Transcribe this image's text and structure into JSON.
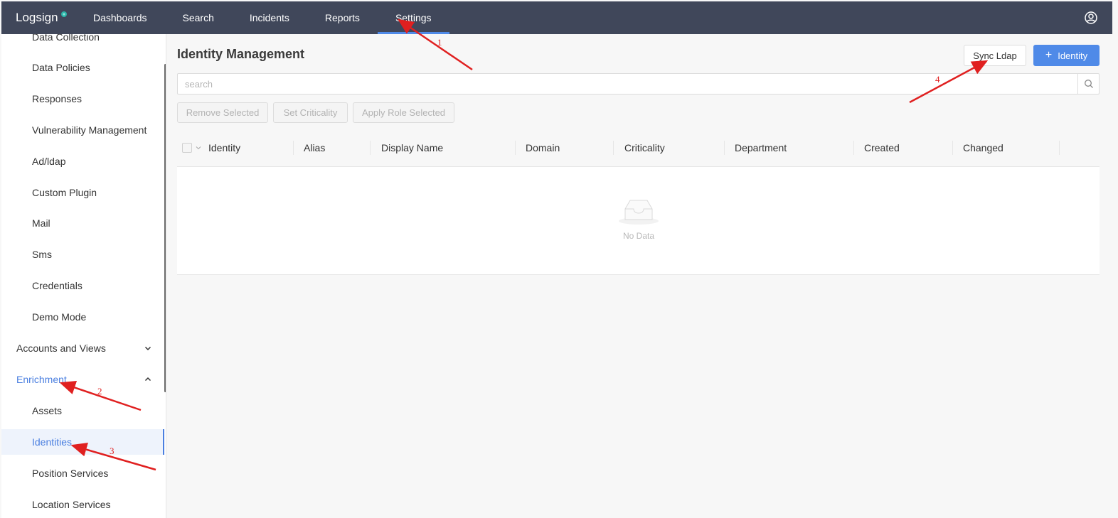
{
  "app": {
    "logo": "Logsign",
    "nav": [
      "Dashboards",
      "Search",
      "Incidents",
      "Reports",
      "Settings"
    ],
    "active_nav": "Settings"
  },
  "sidebar": {
    "items": [
      {
        "label": "Data Collection",
        "type": "sub"
      },
      {
        "label": "Data Policies",
        "type": "sub"
      },
      {
        "label": "Responses",
        "type": "sub"
      },
      {
        "label": "Vulnerability Management",
        "type": "sub"
      },
      {
        "label": "Ad/ldap",
        "type": "sub"
      },
      {
        "label": "Custom Plugin",
        "type": "sub"
      },
      {
        "label": "Mail",
        "type": "sub"
      },
      {
        "label": "Sms",
        "type": "sub"
      },
      {
        "label": "Credentials",
        "type": "sub"
      },
      {
        "label": "Demo Mode",
        "type": "sub"
      },
      {
        "label": "Accounts and Views",
        "type": "group",
        "expanded": false
      },
      {
        "label": "Enrichment",
        "type": "group",
        "expanded": true
      },
      {
        "label": "Assets",
        "type": "sub"
      },
      {
        "label": "Identities",
        "type": "sub",
        "selected": true
      },
      {
        "label": "Position Services",
        "type": "sub"
      },
      {
        "label": "Location Services",
        "type": "sub"
      }
    ]
  },
  "main": {
    "title": "Identity Management",
    "sync_button": "Sync Ldap",
    "add_button": "Identity",
    "search_placeholder": "search",
    "actions": [
      "Remove Selected",
      "Set Criticality",
      "Apply Role Selected"
    ],
    "columns": [
      "Identity",
      "Alias",
      "Display Name",
      "Domain",
      "Criticality",
      "Department",
      "Created",
      "Changed"
    ],
    "empty_text": "No Data"
  },
  "annotations": [
    "1",
    "2",
    "3",
    "4"
  ],
  "colors": {
    "topbar": "#40475a",
    "accent": "#4f8ae8",
    "annotation": "#e02020"
  }
}
